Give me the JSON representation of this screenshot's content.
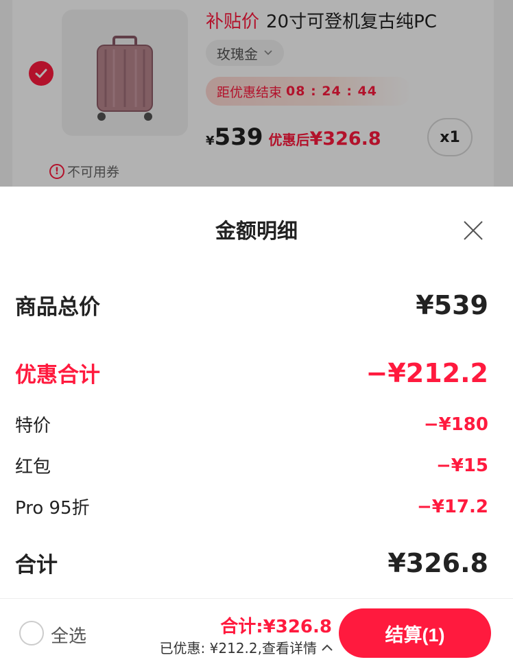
{
  "product": {
    "subsidy_label": "补贴价",
    "title": "20寸可登机复古纯PC",
    "sku": "玫瑰金",
    "countdown_label": "距优惠结束",
    "countdown_time": "08 : 24 : 44",
    "currency": "¥",
    "original_price": "539",
    "after_label": "优惠后",
    "after_price": "¥326.8",
    "quantity": "x1",
    "coupon_note": "不可用券",
    "selected": true
  },
  "sheet": {
    "title": "金额明细",
    "goods_total_label": "商品总价",
    "goods_total_value": "¥539",
    "discount_total_label": "优惠合计",
    "discount_total_value": "−¥212.2",
    "discounts": [
      {
        "label": "特价",
        "value": "−¥180"
      },
      {
        "label": "红包",
        "value": "−¥15"
      },
      {
        "label": "Pro 95折",
        "value": "−¥17.2"
      }
    ],
    "sum_label": "合计",
    "sum_value": "¥326.8"
  },
  "bottom_bar": {
    "select_all_label": "全选",
    "total_text": "合计:¥326.8",
    "saved_text": "已优惠: ¥212.2,查看详情",
    "checkout_label": "结算(1)"
  },
  "colors": {
    "accent": "#ff1a3e",
    "text": "#222222",
    "muted": "#666666"
  }
}
